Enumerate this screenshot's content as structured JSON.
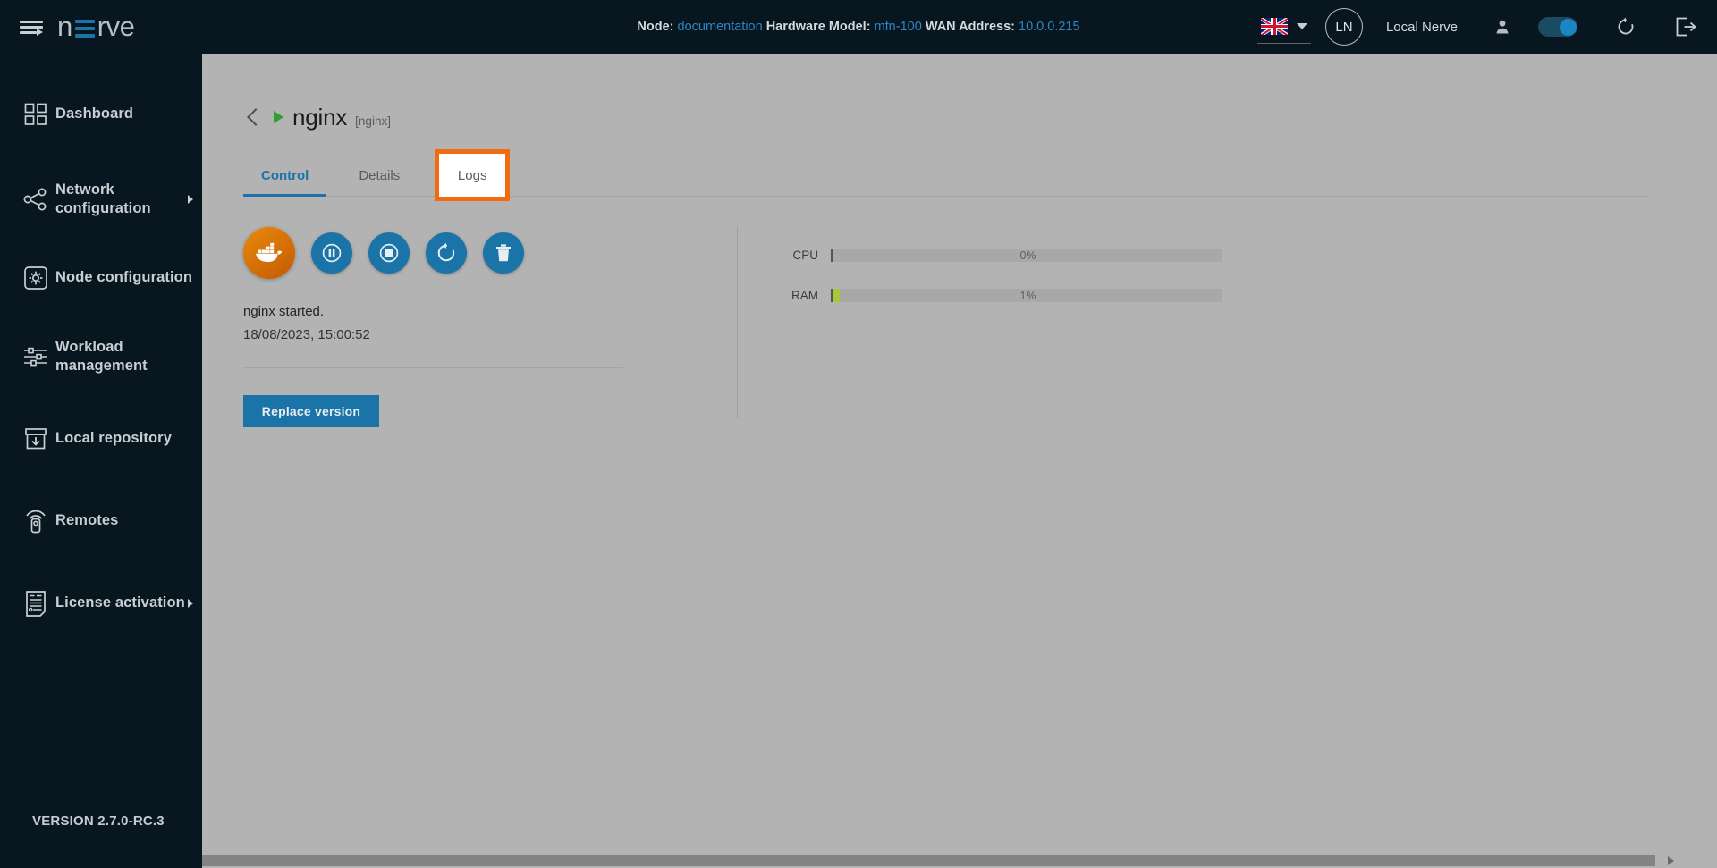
{
  "topbar": {
    "logo_text": "nerve",
    "menu_icon": "hamburger-menu-icon",
    "node_label": "Node:",
    "node_value": "documentation",
    "hardware_label": "Hardware Model:",
    "hardware_value": "mfn-100",
    "wan_label": "WAN Address:",
    "wan_value": "10.0.0.215",
    "language_flag": "uk-flag-icon",
    "avatar_initials": "LN",
    "user_name": "Local Nerve",
    "person_icon": "person-icon",
    "toggle_state": "on",
    "refresh_icon": "refresh-icon",
    "logout_icon": "logout-icon",
    "accent_blue": "#1b74a8",
    "background": "#081620"
  },
  "sidebar": {
    "items": [
      {
        "label": "Dashboard",
        "icon": "dashboard-grid-icon",
        "has_arrow": false
      },
      {
        "label": "Network configuration",
        "icon": "network-share-icon",
        "has_arrow": true
      },
      {
        "label": "Node configuration",
        "icon": "node-gear-icon",
        "has_arrow": false
      },
      {
        "label": "Workload management",
        "icon": "sliders-icon",
        "has_arrow": false
      },
      {
        "label": "Local repository",
        "icon": "repository-download-icon",
        "has_arrow": false
      },
      {
        "label": "Remotes",
        "icon": "remote-control-icon",
        "has_arrow": false
      },
      {
        "label": "License activation",
        "icon": "license-document-icon",
        "has_arrow": true
      }
    ],
    "version": "VERSION 2.7.0-RC.3"
  },
  "main": {
    "back_icon": "back-chevron-icon",
    "status_icon": "play-triangle-icon",
    "title": "nginx",
    "subtitle": "[nginx]",
    "tabs": [
      {
        "label": "Control",
        "active": true,
        "highlighted": false
      },
      {
        "label": "Details",
        "active": false,
        "highlighted": false
      },
      {
        "label": "Logs",
        "active": false,
        "highlighted": true
      }
    ],
    "highlight_color": "#f26b0f",
    "controls": [
      {
        "name": "docker-icon-button",
        "icon": "docker-whale-icon"
      },
      {
        "name": "pause-button",
        "icon": "pause-icon"
      },
      {
        "name": "stop-button",
        "icon": "stop-icon"
      },
      {
        "name": "restart-button",
        "icon": "restart-icon"
      },
      {
        "name": "delete-button",
        "icon": "trash-icon"
      }
    ],
    "status_text": "nginx started.",
    "status_timestamp": "18/08/2023, 15:00:52",
    "replace_button": "Replace version",
    "meters": [
      {
        "label": "CPU",
        "value": "0%",
        "percent": 0
      },
      {
        "label": "RAM",
        "value": "1%",
        "percent": 1.6
      }
    ],
    "meter_fill_color": "#a8c837"
  }
}
